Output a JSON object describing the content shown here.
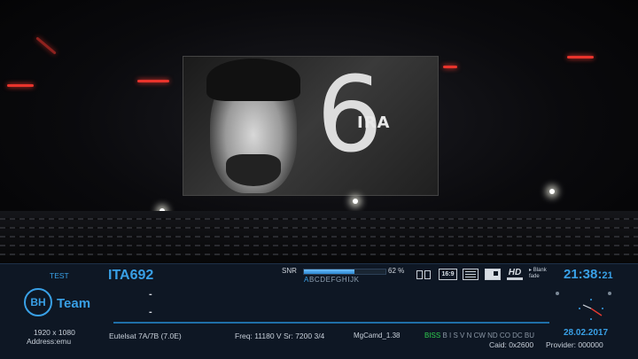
{
  "infobar": {
    "service_label": "TEST",
    "channel_name": "ITA692",
    "logo_initials": "BH",
    "logo_text": "Team",
    "event_now": "-",
    "event_next": "-",
    "resolution": "1920 x 1080",
    "address": "Address:emu",
    "satellite": "Eutelsat 7A/7B (7.0E)",
    "frequency": "Freq: 11180 V Sr: 7200 3/4",
    "emulator": "MgCamd_1.38",
    "cas_active": "BISS",
    "cas_others": "B I S V N CW ND CO DC BU",
    "caid": "Caid: 0x2600",
    "provider": "Provider: 000000",
    "snr_label": "SNR",
    "snr_value": "62 %",
    "snr_fraction": 0.62,
    "tuner_active": "A",
    "tuner_others": "BCDEFGHIJK",
    "aspect_label": "16:9",
    "hd_label": "HD",
    "blank_label_1": "Blank",
    "blank_label_2": "fade",
    "clock_hm": "21:38:",
    "clock_s": "21",
    "date": "28.02.2017"
  },
  "broadcast": {
    "jersey_number": "6",
    "jersey_name": "IRA"
  },
  "colors": {
    "accent": "#39a0e6",
    "cas_active": "#2fcf4f",
    "background": "#0e1724"
  }
}
